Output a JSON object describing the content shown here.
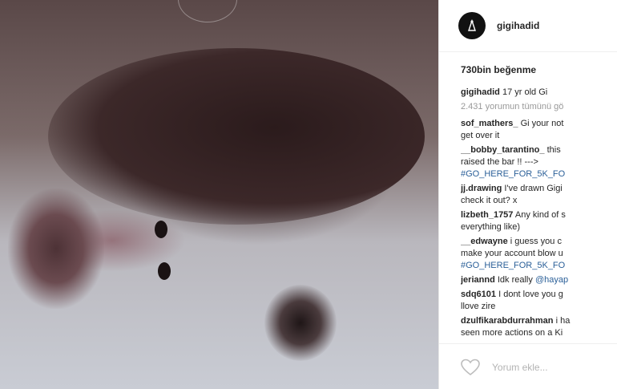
{
  "post": {
    "username": "gigihadid",
    "likes": "730bin beğenme",
    "caption": {
      "user": "gigihadid",
      "text": "17 yr old Gi"
    },
    "view_all": "2.431 yorumun tümünü gö",
    "comments": [
      {
        "user": "sof_mathers_",
        "lines": [
          "Gi your not",
          "get over it"
        ]
      },
      {
        "user": "__bobby_tarantino_",
        "lines": [
          "this",
          "raised the bar !! --->",
          "#GO_HERE_FOR_5K_FO"
        ]
      },
      {
        "user": "jj.drawing",
        "lines": [
          "I've drawn Gigi",
          "check it out? x"
        ]
      },
      {
        "user": "lizbeth_1757",
        "lines": [
          "Any kind of s",
          "everything like)"
        ]
      },
      {
        "user": "__edwayne",
        "lines": [
          "i guess you c",
          "make your account blow u",
          "#GO_HERE_FOR_5K_FO"
        ]
      },
      {
        "user": "jeriannd",
        "lines": [
          "Idk really @hayap"
        ]
      },
      {
        "user": "sdq6101",
        "lines": [
          "I dont love you g",
          "llove zire"
        ]
      },
      {
        "user": "dzulfikarabdurrahman",
        "lines": [
          "i ha",
          "seen more actions on a Ki"
        ]
      }
    ],
    "add_comment_placeholder": "Yorum ekle...",
    "icons": {
      "like": "heart-icon",
      "avatar": "avatar-logo-icon"
    }
  }
}
